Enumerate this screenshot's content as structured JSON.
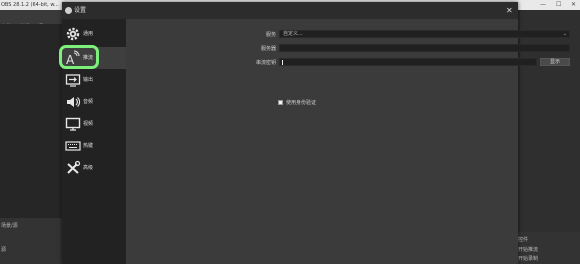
{
  "main_window": {
    "title": "OBS 28.1.2 (64-bit, w...",
    "menu": "文件(F)   编辑(E)   视",
    "window_controls": {
      "minimize": "—",
      "maximize": "☐",
      "close": "✕"
    },
    "left_panel_label_1": "场景/源",
    "left_panel_label_2": "源",
    "right_panel_label_1": "控件",
    "right_panel_label_2": "开始推流",
    "right_panel_label_3": "开始录制"
  },
  "dialog": {
    "title": "设置",
    "close": "✕",
    "nav": [
      {
        "label": "通用",
        "icon": "gear-icon"
      },
      {
        "label": "推流",
        "icon": "stream-icon",
        "active": true
      },
      {
        "label": "输出",
        "icon": "output-icon"
      },
      {
        "label": "音频",
        "icon": "speaker-icon"
      },
      {
        "label": "视频",
        "icon": "monitor-icon"
      },
      {
        "label": "热键",
        "icon": "keyboard-icon"
      },
      {
        "label": "高级",
        "icon": "tools-icon"
      }
    ],
    "stream": {
      "service_label": "服务",
      "service_value": "自定义...",
      "server_label": "服务器",
      "server_value": "",
      "key_label": "串流密钥",
      "key_value": "",
      "show_button": "显示",
      "auth_label": "使用身份验证"
    }
  }
}
